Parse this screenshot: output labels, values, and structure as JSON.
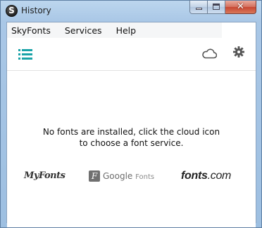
{
  "window": {
    "title": "History",
    "close_glyph": "✕"
  },
  "menu": {
    "items": [
      "SkyFonts",
      "Services",
      "Help"
    ]
  },
  "toolbar": {
    "icons": [
      "list-icon",
      "cloud-icon",
      "gear-icon"
    ],
    "accent_color": "#1aa3a8"
  },
  "main": {
    "message_line1": "No fonts are installed, click the cloud icon",
    "message_line2": "to choose a font service."
  },
  "services": {
    "myfonts": "MyFonts",
    "google_mark": "F",
    "google": "Google",
    "google_suffix": "Fonts",
    "fontscom": "fonts",
    "fontscom_suffix": ".com"
  }
}
